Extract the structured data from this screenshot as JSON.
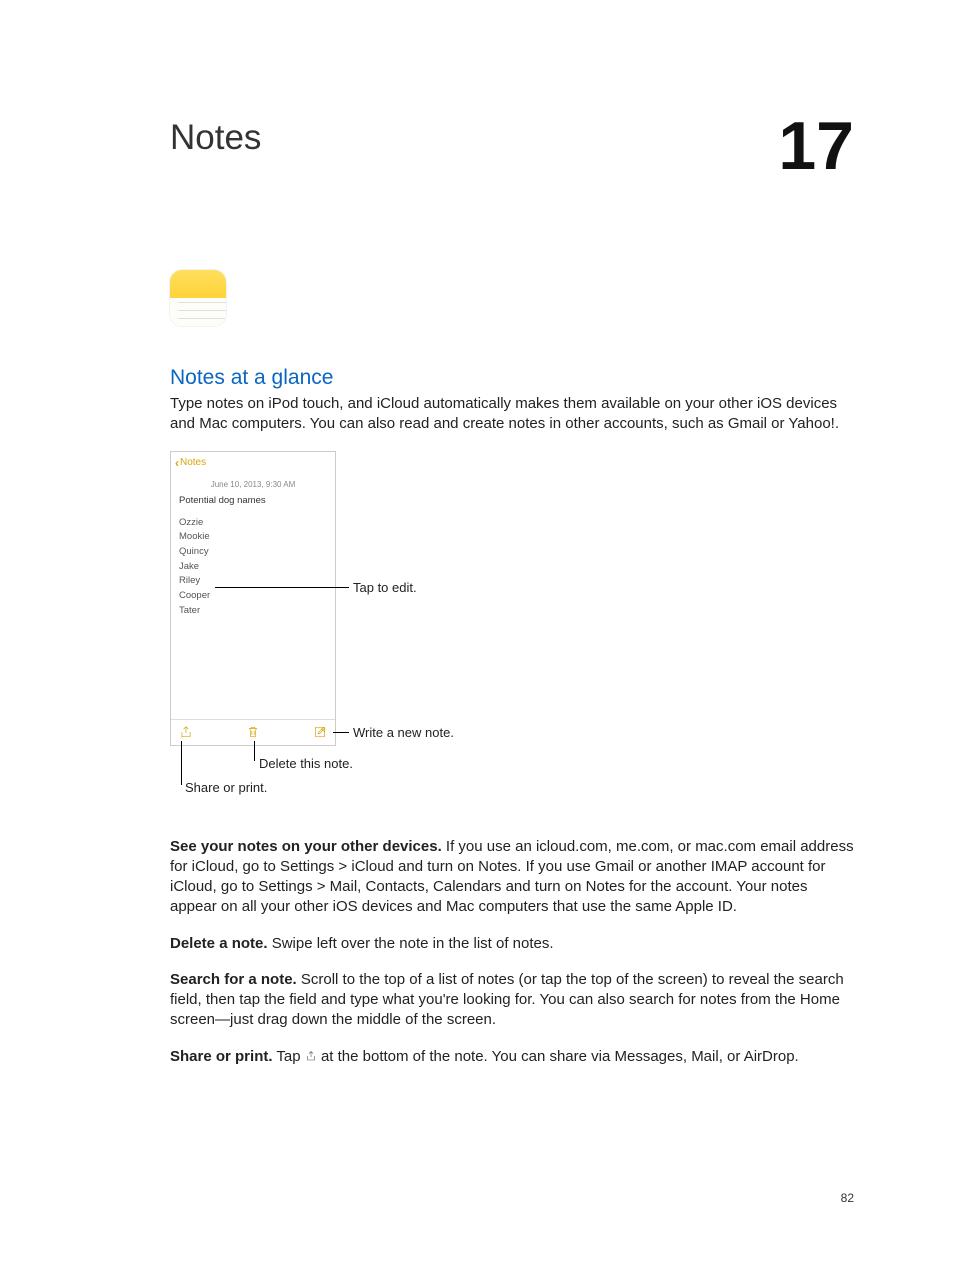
{
  "chapter": {
    "title": "Notes",
    "number": "17"
  },
  "section": {
    "title": "Notes at a glance",
    "intro": "Type notes on iPod touch, and iCloud automatically makes them available on your other iOS devices and Mac computers. You can also read and create notes in other accounts, such as Gmail or Yahoo!."
  },
  "figure": {
    "nav_back": "Notes",
    "date": "June 10, 2013, 9:30 AM",
    "note_title": "Potential dog names",
    "lines": [
      "Ozzie",
      "Mookie",
      "Quincy",
      "Jake",
      "Riley",
      "Cooper",
      "Tater"
    ],
    "callout_edit": "Tap to edit.",
    "callout_new": "Write a new note.",
    "callout_delete": "Delete this note.",
    "callout_share": "Share or print."
  },
  "paragraphs": {
    "p1_b": "See your notes on your other devices.",
    "p1": " If you use an icloud.com, me.com, or mac.com email address for iCloud, go to Settings > iCloud and turn on Notes. If you use Gmail or another IMAP account for iCloud, go to Settings > Mail, Contacts, Calendars and turn on Notes for the account. Your notes appear on all your other iOS devices and Mac computers that use the same Apple ID.",
    "p2_b": "Delete a note.",
    "p2": " Swipe left over the note in the list of notes.",
    "p3_b": "Search for a note.",
    "p3": " Scroll to the top of a list of notes (or tap the top of the screen) to reveal the search field, then tap the field and type what you're looking for. You can also search for notes from the Home screen—just drag down the middle of the screen.",
    "p4_b": "Share or print.",
    "p4a": " Tap ",
    "p4b": " at the bottom of the note. You can share via Messages, Mail, or AirDrop."
  },
  "page_number": "82"
}
